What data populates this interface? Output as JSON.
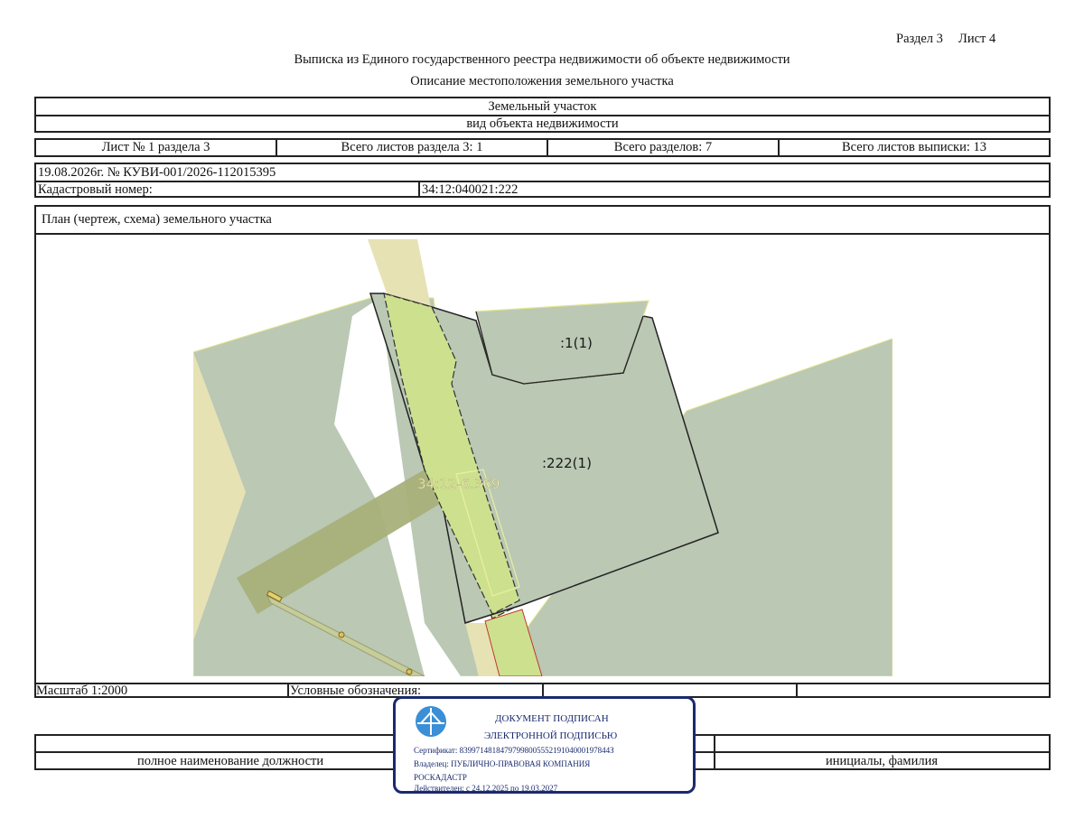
{
  "header": {
    "section_ref": "Раздел 3",
    "sheet_ref": "Лист 4",
    "title": "Выписка из Единого государственного реестра недвижимости об объекте недвижимости",
    "subtitle": "Описание местоположения земельного участка"
  },
  "object": {
    "type": "Земельный участок",
    "type_caption": "вид объекта недвижимости"
  },
  "sheets": {
    "sheet_of_section": "Лист № 1 раздела 3",
    "total_sheets_section": "Всего листов раздела 3: 1",
    "total_sections": "Всего разделов: 7",
    "total_sheets_extract": "Всего листов выписки: 13"
  },
  "record": {
    "date_number": "19.08.2026г. № КУВИ-001/2026-112015395",
    "cadastral_label": "Кадастровый номер:",
    "cadastral_value": "34:12:040021:222"
  },
  "plan": {
    "title": "План (чертеж, схема) земельного участка",
    "labels": {
      "parcel_1": ":1(1)",
      "parcel_222": ":222(1)",
      "zone": "34:12-6.369"
    },
    "colors": {
      "parcel_fill": "#bac8b4",
      "light_green": "#cde08e",
      "beige_road": "#e6e2b4",
      "dark_strip": "#a8b07a",
      "red_line": "#c0392b"
    }
  },
  "legend_row": {
    "scale": "Масштаб 1:2000",
    "legend": "Условные обозначения:"
  },
  "signature": {
    "position_caption": "полное наименование должности",
    "initials_caption": "инициалы, фамилия"
  },
  "stamp": {
    "line1": "ДОКУМЕНТ ПОДПИСАН",
    "line2": "ЭЛЕКТРОННОЙ ПОДПИСЬЮ",
    "certificate": "Сертификат: 8399714818479799800555219104000197844З",
    "owner_line1": "Владелец: ПУБЛИЧНО-ПРАВОВАЯ КОМПАНИЯ",
    "owner_line2": "РОСКАДАСТР",
    "valid": "Действителен: с 24.12.2025 по 19.03.2027",
    "logo_icon": "roskadastr-logo-icon"
  }
}
